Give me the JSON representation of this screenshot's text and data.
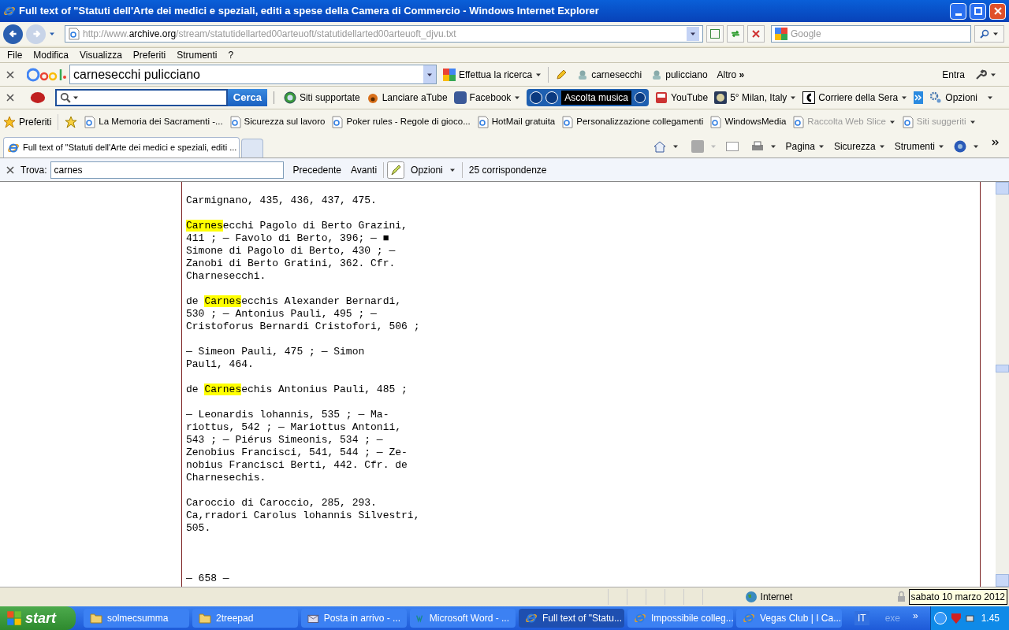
{
  "window": {
    "title": "Full text of \"Statuti dell'Arte dei medici e speziali, editi a spese della Camera di Commercio  - Windows Internet Explorer"
  },
  "address": {
    "prefix": "http://www.",
    "host": "archive.org",
    "path": "/stream/statutidellarted00arteuoft/statutidellarted00arteuoft_djvu.txt",
    "search_placeholder": "Google"
  },
  "menu": [
    "File",
    "Modifica",
    "Visualizza",
    "Preferiti",
    "Strumenti",
    "?"
  ],
  "google_bar": {
    "query": "carnesecchi pulicciano",
    "search_button": "Effettua la ricerca",
    "terms": [
      "carnesecchi",
      "pulicciano"
    ],
    "more": "Altro",
    "more_glyph": "»",
    "sign_in": "Entra"
  },
  "ask_bar": {
    "search_button": "Cerca",
    "items": [
      {
        "kind": "globe",
        "label": "Siti supportate",
        "dropdown": false
      },
      {
        "kind": "paw",
        "label": "Lanciare aTube",
        "dropdown": false
      },
      {
        "kind": "facebook",
        "label": "Facebook",
        "dropdown": true
      }
    ],
    "music": "Ascolta musica",
    "items2": [
      {
        "kind": "youtube",
        "label": "YouTube",
        "dropdown": false
      },
      {
        "kind": "weather",
        "label": "5° Milan, Italy",
        "dropdown": true
      },
      {
        "kind": "corriere",
        "label": "Corriere della Sera",
        "dropdown": true
      }
    ],
    "options": "Opzioni"
  },
  "favorites_bar": {
    "label": "Preferiti",
    "links": [
      {
        "label": "La Memoria dei Sacramenti -...",
        "disabled": false,
        "dropdown": false
      },
      {
        "label": "Sicurezza sul lavoro",
        "disabled": false,
        "dropdown": false
      },
      {
        "label": "Poker rules - Regole di gioco...",
        "disabled": false,
        "dropdown": false
      },
      {
        "label": "HotMail gratuita",
        "disabled": false,
        "dropdown": false
      },
      {
        "label": "Personalizzazione collegamenti",
        "disabled": false,
        "dropdown": false
      },
      {
        "label": "WindowsMedia",
        "disabled": false,
        "dropdown": false
      },
      {
        "label": "Raccolta Web Slice",
        "disabled": true,
        "dropdown": true
      },
      {
        "label": "Siti suggeriti",
        "disabled": true,
        "dropdown": true
      }
    ]
  },
  "tabs": [
    {
      "label": "Full text of \"Statuti dell'Arte dei medici e speziali, editi ...",
      "selected": true
    }
  ],
  "command_bar": [
    "Pagina",
    "Sicurezza",
    "Strumenti"
  ],
  "find_bar": {
    "label": "Trova:",
    "value": "carnes",
    "previous": "Precedente",
    "next": "Avanti",
    "options": "Opzioni",
    "result": "25 corrispondenze"
  },
  "document": {
    "paragraphs": [
      [
        [
          {
            "text": "Carmignano, 435, 436, 437, 475.",
            "highlighted": false
          }
        ]
      ],
      [
        [
          {
            "text": "Carnes",
            "highlighted": true
          },
          {
            "text": "ecchi Pagolo di Berto Grazini,",
            "highlighted": false
          }
        ],
        [
          {
            "text": "411 ; — Favolo di Berto, 396; — ■",
            "highlighted": false
          }
        ],
        [
          {
            "text": "Simone di Pagolo di Berto, 430 ; —",
            "highlighted": false
          }
        ],
        [
          {
            "text": "Zanobi di Berto Gratini, 362. Cfr.",
            "highlighted": false
          }
        ],
        [
          {
            "text": "Charnesecchi.",
            "highlighted": false
          }
        ]
      ],
      [
        [
          {
            "text": "de ",
            "highlighted": false
          },
          {
            "text": "Carnes",
            "highlighted": true
          },
          {
            "text": "ecchis Alexander Bernardi,",
            "highlighted": false
          }
        ],
        [
          {
            "text": "530 ; — Antonius Pauli, 495 ; —",
            "highlighted": false
          }
        ],
        [
          {
            "text": "Cristoforus Bernardi Cristofori, 506 ;",
            "highlighted": false
          }
        ]
      ],
      [
        [
          {
            "text": "— Simeon Pauli, 475 ; — Simon",
            "highlighted": false
          }
        ],
        [
          {
            "text": "Pauli, 464.",
            "highlighted": false
          }
        ]
      ],
      [
        [
          {
            "text": "de ",
            "highlighted": false
          },
          {
            "text": "Carnes",
            "highlighted": true
          },
          {
            "text": "echis Antonius Pauli, 485 ;",
            "highlighted": false
          }
        ]
      ],
      [
        [
          {
            "text": "— Leonardis lohannis, 535 ; — Ma-",
            "highlighted": false
          }
        ],
        [
          {
            "text": "riottus, 542 ; — Mariottus Antonii,",
            "highlighted": false
          }
        ],
        [
          {
            "text": "543 ; — Piérus Simeonis, 534 ; —",
            "highlighted": false
          }
        ],
        [
          {
            "text": "Zenobius Francisci, 541, 544 ; — Ze-",
            "highlighted": false
          }
        ],
        [
          {
            "text": "nobius Francisci Berti, 442. Cfr. de",
            "highlighted": false
          }
        ],
        [
          {
            "text": "Charnesechis.",
            "highlighted": false
          }
        ]
      ],
      [
        [
          {
            "text": "Caroccio di Caroccio, 285, 293.",
            "highlighted": false
          }
        ],
        [
          {
            "text": "Ca,rradori Carolus lohannis Silvestri,",
            "highlighted": false
          }
        ],
        [
          {
            "text": "505.",
            "highlighted": false
          }
        ]
      ]
    ],
    "page_number": "— 658 —"
  },
  "status_bar": {
    "zone": "Internet",
    "tooltip": "sabato 10 marzo 2012"
  },
  "taskbar": {
    "start": "start",
    "tasks": [
      {
        "kind": "folder",
        "label": "solmecsumma",
        "selected": false
      },
      {
        "kind": "folder",
        "label": "2treepad",
        "selected": false
      },
      {
        "kind": "mail",
        "label": "Posta in arrivo - ...",
        "selected": false
      },
      {
        "kind": "word",
        "label": "Microsoft Word - ...",
        "selected": false
      },
      {
        "kind": "ie",
        "label": "Full text of \"Statu...",
        "selected": true
      },
      {
        "kind": "ie",
        "label": "Impossibile colleg...",
        "selected": false
      },
      {
        "kind": "ie",
        "label": "Vegas Club | I Ca...",
        "selected": false
      }
    ],
    "language": "IT",
    "toolbar": "exe",
    "more": "»",
    "clock": "1.45"
  }
}
